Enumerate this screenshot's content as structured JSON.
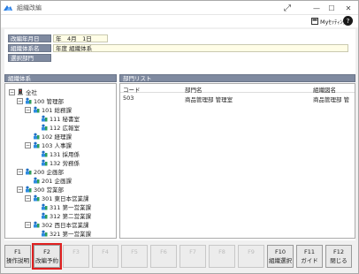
{
  "window": {
    "title": "組織改編",
    "maximize_glyph": "⤢",
    "minimize_glyph": "—",
    "restore_glyph": "☐",
    "close_glyph": "✕"
  },
  "toolbar": {
    "mysettings_label": "Myｾｯﾃｨﾝｸﾞ",
    "help_label": "?"
  },
  "header_fields": {
    "date_label": "改編年月日",
    "date_value": "年　4月　1日",
    "system_label": "組織体系名",
    "system_value": "年度 組織体系",
    "dept_label": "選択部門",
    "dept_value": ""
  },
  "tree": {
    "title": "組織体系",
    "nodes": [
      {
        "label": "全社",
        "indent": 0,
        "expander": "−",
        "icon": "root"
      },
      {
        "label": "100 管理部",
        "indent": 1,
        "expander": "−",
        "icon": "org"
      },
      {
        "label": "101 総務課",
        "indent": 2,
        "expander": "−",
        "icon": "org"
      },
      {
        "label": "111 秘書室",
        "indent": 3,
        "expander": "",
        "icon": "org"
      },
      {
        "label": "112 広報室",
        "indent": 3,
        "expander": "",
        "icon": "org"
      },
      {
        "label": "102 経理課",
        "indent": 2,
        "expander": "",
        "icon": "org"
      },
      {
        "label": "103 人事課",
        "indent": 2,
        "expander": "−",
        "icon": "org"
      },
      {
        "label": "131 採用係",
        "indent": 3,
        "expander": "",
        "icon": "org"
      },
      {
        "label": "132 労務係",
        "indent": 3,
        "expander": "",
        "icon": "org"
      },
      {
        "label": "200 企画部",
        "indent": 1,
        "expander": "−",
        "icon": "org"
      },
      {
        "label": "201 企画課",
        "indent": 2,
        "expander": "",
        "icon": "org"
      },
      {
        "label": "300 営業部",
        "indent": 1,
        "expander": "−",
        "icon": "org"
      },
      {
        "label": "301 東日本営業課",
        "indent": 2,
        "expander": "−",
        "icon": "org"
      },
      {
        "label": "311 第一営業課",
        "indent": 3,
        "expander": "",
        "icon": "org"
      },
      {
        "label": "312 第二営業課",
        "indent": 3,
        "expander": "",
        "icon": "org"
      },
      {
        "label": "302 西日本営業課",
        "indent": 2,
        "expander": "−",
        "icon": "org"
      },
      {
        "label": "321 第一営業課",
        "indent": 3,
        "expander": "",
        "icon": "org"
      }
    ]
  },
  "dept_list": {
    "title": "部門リスト",
    "columns": [
      "コード",
      "部門名",
      "組織図名"
    ],
    "rows": [
      [
        "503",
        "商品管理部 管理室",
        "商品管理部 管"
      ]
    ]
  },
  "function_keys": [
    {
      "key": "F1",
      "label": "操作説明",
      "disabled": false,
      "highlight": false
    },
    {
      "key": "F2",
      "label": "改編予約",
      "disabled": false,
      "highlight": true
    },
    {
      "key": "F3",
      "label": "",
      "disabled": true,
      "highlight": false
    },
    {
      "key": "F4",
      "label": "",
      "disabled": true,
      "highlight": false
    },
    {
      "key": "F5",
      "label": "",
      "disabled": true,
      "highlight": false
    },
    {
      "key": "F6",
      "label": "",
      "disabled": true,
      "highlight": false
    },
    {
      "key": "F7",
      "label": "",
      "disabled": true,
      "highlight": false
    },
    {
      "key": "F8",
      "label": "",
      "disabled": true,
      "highlight": false
    },
    {
      "key": "F9",
      "label": "",
      "disabled": true,
      "highlight": false
    },
    {
      "key": "F10",
      "label": "組織選択",
      "disabled": false,
      "highlight": false
    },
    {
      "key": "F11",
      "label": "ガイド",
      "disabled": false,
      "highlight": false
    },
    {
      "key": "F12",
      "label": "閉じる",
      "disabled": false,
      "highlight": false
    }
  ],
  "colors": {
    "label_bg": "#7f8aa0",
    "value_bg": "#fffde6",
    "highlight": "#e02020"
  }
}
